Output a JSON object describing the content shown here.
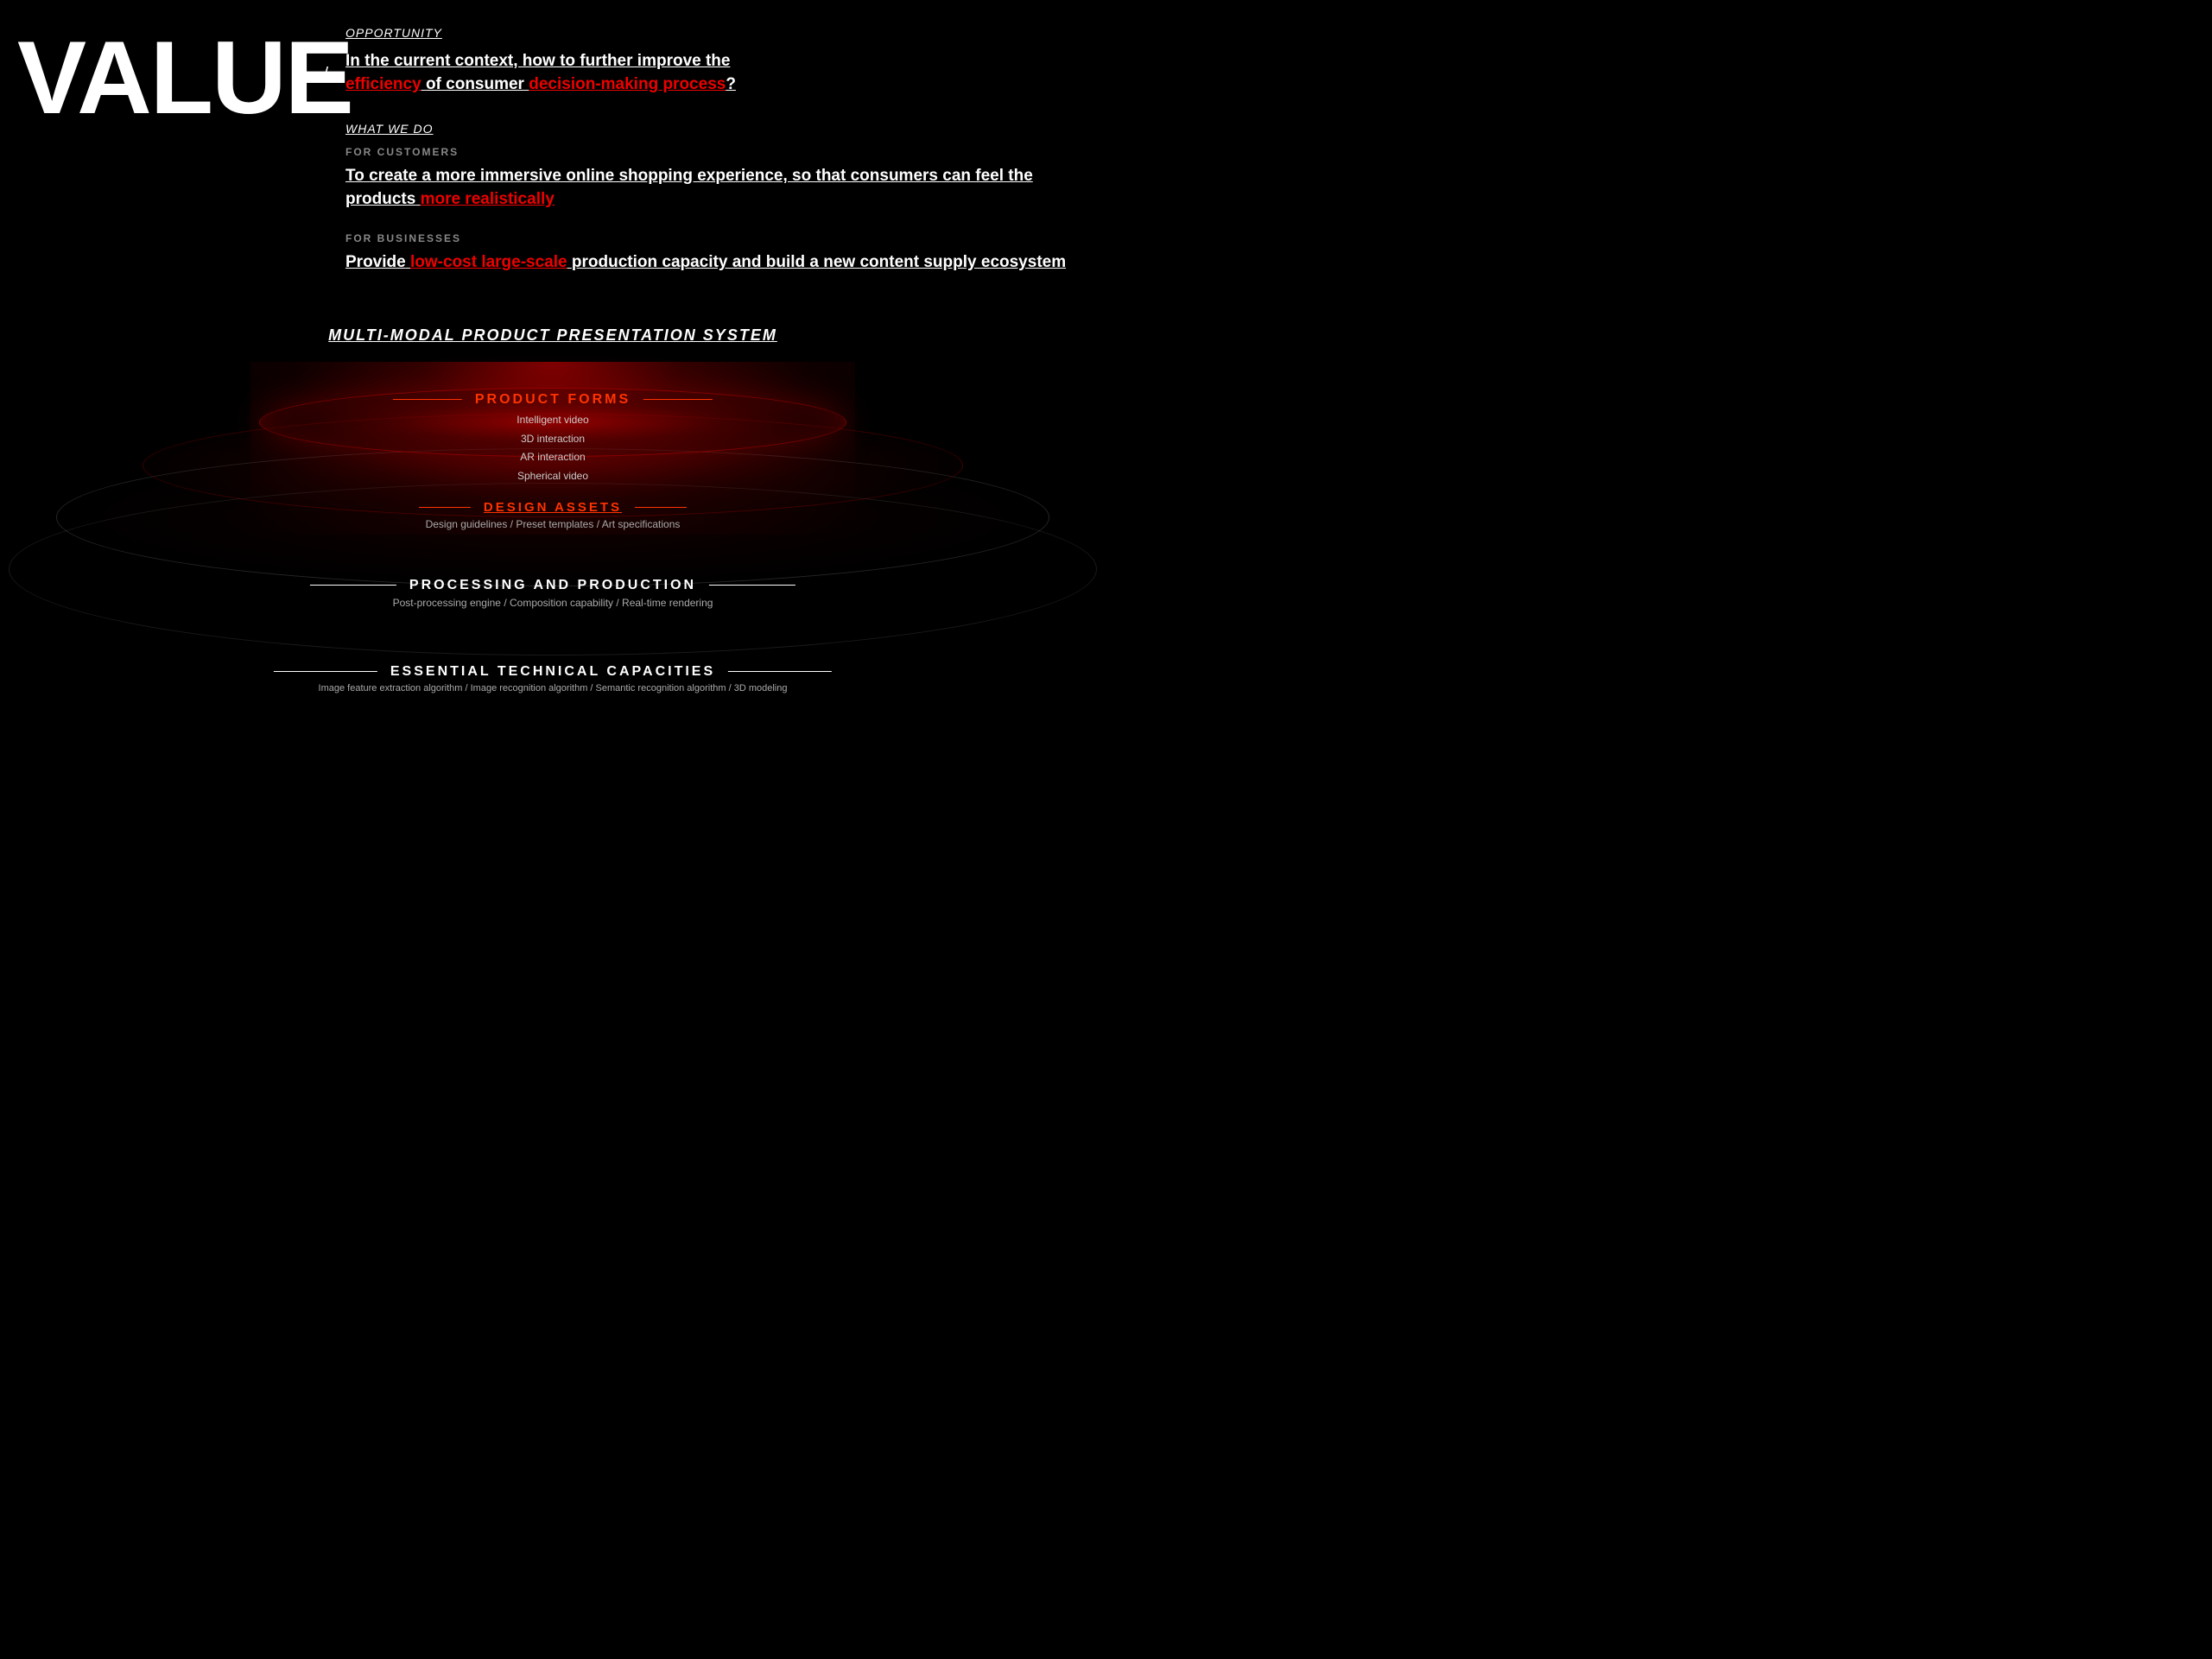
{
  "header": {
    "value_logo": "VALUE",
    "arrow": "/"
  },
  "opportunity": {
    "label": "OPPORTUNITY",
    "question_part1": "In the current context, how to further improve the",
    "question_efficiency": "efficiency",
    "question_part2": "of consumer",
    "question_decision": "decision-making process",
    "question_end": "?"
  },
  "what_we_do": {
    "label": "WHAT WE DO",
    "for_customers": {
      "section_label": "FOR CUSTOMERS",
      "statement_part1": "To create a more immersive online shopping experience, so that consumers can feel the products",
      "statement_red": "more realistically"
    },
    "for_businesses": {
      "section_label": "FOR BUSINESSES",
      "statement_part1": "Provide",
      "statement_red": "low-cost large-scale",
      "statement_part2": "production capacity and build a new content supply ecosystem"
    }
  },
  "diagram": {
    "title": "MULTI-MODAL PRODUCT PRESENTATION SYSTEM",
    "layers": {
      "product_forms": {
        "title": "PRODUCT FORMS",
        "items": [
          "Intelligent video",
          "3D interaction",
          "AR interaction",
          "Spherical video"
        ]
      },
      "design_assets": {
        "title": "DESIGN ASSETS",
        "items": "Design guidelines / Preset templates / Art specifications"
      },
      "processing": {
        "title": "PROCESSING AND PRODUCTION",
        "items": "Post-processing engine / Composition capability / Real-time rendering"
      },
      "essential": {
        "title": "ESSENTIAL TECHNICAL CAPACITIES",
        "items": "Image feature extraction algorithm / Image recognition algorithm / Semantic recognition algorithm / 3D modeling"
      }
    }
  }
}
